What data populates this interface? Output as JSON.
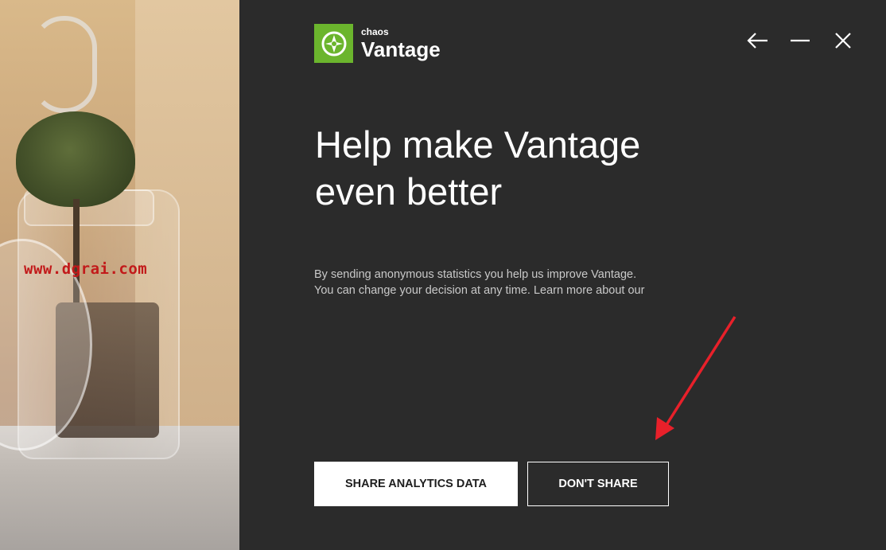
{
  "hero": {
    "watermark": "www.dgrai.com"
  },
  "logo": {
    "brand": "chaos",
    "product": "Vantage"
  },
  "window_controls": {
    "back_icon": "arrow-left-icon",
    "minimize_icon": "minimize-icon",
    "close_icon": "close-icon"
  },
  "content": {
    "headline_line1": "Help make Vantage",
    "headline_line2": "even better",
    "body_line1": "By sending anonymous statistics you help us improve Vantage.",
    "body_line2": "You can change your decision at any time. Learn more about our"
  },
  "actions": {
    "share_label": "SHARE ANALYTICS DATA",
    "dont_share_label": "DON'T SHARE"
  },
  "colors": {
    "background": "#2b2b2b",
    "accent": "#6bb52d",
    "annotation": "#e8202a"
  }
}
